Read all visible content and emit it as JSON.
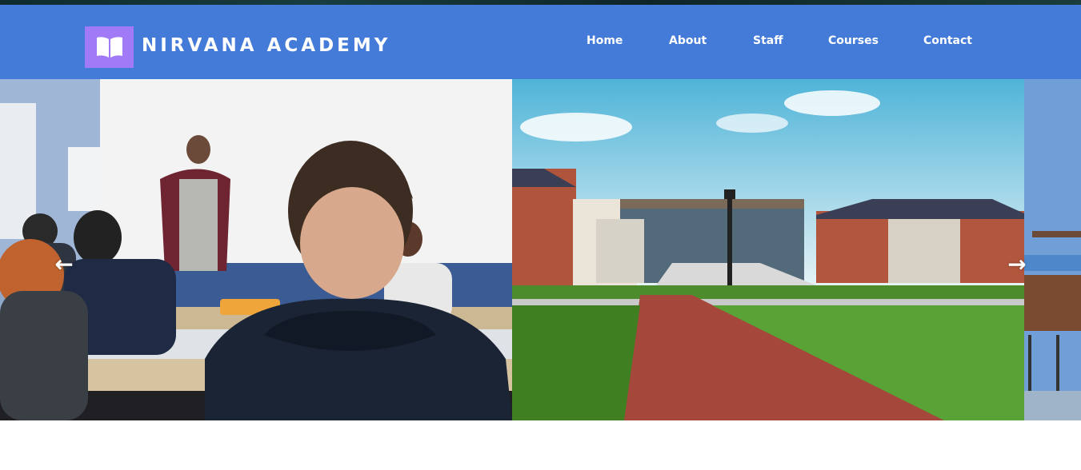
{
  "brand": {
    "name": "NIRVANA ACADEMY",
    "logo_icon": "open-book-icon"
  },
  "nav": {
    "items": [
      {
        "label": "Home"
      },
      {
        "label": "About"
      },
      {
        "label": "Staff"
      },
      {
        "label": "Courses"
      },
      {
        "label": "Contact"
      }
    ]
  },
  "carousel": {
    "slides": [
      {
        "subject": "classroom"
      },
      {
        "subject": "campus"
      },
      {
        "subject": "empty classroom"
      }
    ],
    "prev_icon": "arrow-left-icon",
    "next_icon": "arrow-right-icon"
  },
  "colors": {
    "header": "#457bd8",
    "logo_bg": "#a07af7"
  }
}
